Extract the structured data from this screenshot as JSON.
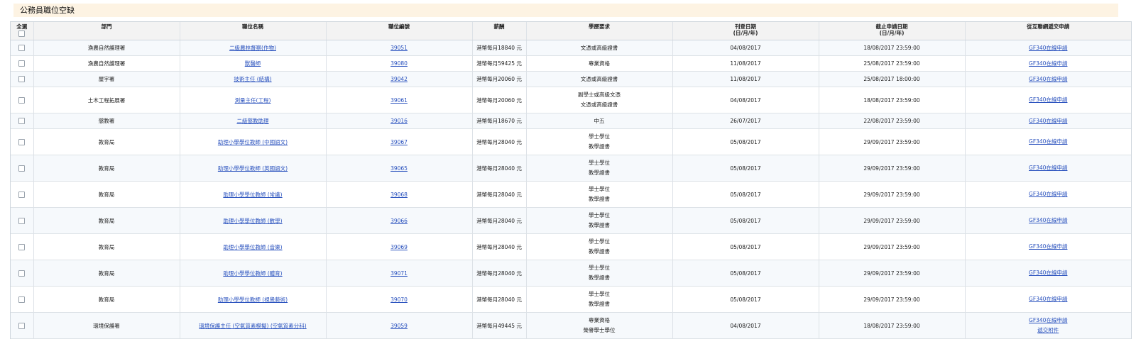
{
  "page": {
    "title": "公務員職位空缺"
  },
  "table": {
    "headers": {
      "select_all": "全選",
      "department": "部門",
      "position": "職位名稱",
      "ref": "職位編號",
      "salary": "薪酬",
      "requirement": "學歷要求",
      "publish_line1": "刊登日期",
      "publish_line2": "(日/月/年)",
      "deadline_line1": "截止申請日期",
      "deadline_line2": "(日/月/年)",
      "apply": "從互聯網遞交申請"
    },
    "rows": [
      {
        "department": "漁農自然護理署",
        "position": "二級農林督察(作物)",
        "ref": "39051",
        "salary": "港幣每月18840 元",
        "requirement": [
          "文憑或高級證書"
        ],
        "publish": "04/08/2017",
        "deadline": "18/08/2017 23:59:00",
        "apply": [
          "GF340在線申請"
        ]
      },
      {
        "department": "漁農自然護理署",
        "position": "獸醫師",
        "ref": "39080",
        "salary": "港幣每月59425 元",
        "requirement": [
          "專業資格"
        ],
        "publish": "11/08/2017",
        "deadline": "25/08/2017 23:59:00",
        "apply": [
          "GF340在線申請"
        ]
      },
      {
        "department": "屋宇署",
        "position": "技術主任 (結構)",
        "ref": "39042",
        "salary": "港幣每月20060 元",
        "requirement": [
          "文憑或高級證書"
        ],
        "publish": "11/08/2017",
        "deadline": "25/08/2017 18:00:00",
        "apply": [
          "GF340在線申請"
        ]
      },
      {
        "department": "土木工程拓展署",
        "position": "測量主任(工程)",
        "ref": "39061",
        "salary": "港幣每月20060 元",
        "requirement": [
          "副學士或高級文憑",
          "文憑或高級證書"
        ],
        "publish": "04/08/2017",
        "deadline": "18/08/2017 23:59:00",
        "apply": [
          "GF340在線申請"
        ]
      },
      {
        "department": "懲教署",
        "position": "二級懲教助理",
        "ref": "39016",
        "salary": "港幣每月18670 元",
        "requirement": [
          "中五"
        ],
        "publish": "26/07/2017",
        "deadline": "22/08/2017 23:59:00",
        "apply": [
          "GF340在線申請"
        ]
      },
      {
        "department": "教育局",
        "position": "助理小學學位教師 (中國語文)",
        "ref": "39067",
        "salary": "港幣每月28040 元",
        "requirement": [
          "學士學位",
          "教學證書"
        ],
        "publish": "05/08/2017",
        "deadline": "29/09/2017 23:59:00",
        "apply": [
          "GF340在線申請"
        ]
      },
      {
        "department": "教育局",
        "position": "助理小學學位教師 (英國語文)",
        "ref": "39065",
        "salary": "港幣每月28040 元",
        "requirement": [
          "學士學位",
          "教學證書"
        ],
        "publish": "05/08/2017",
        "deadline": "29/09/2017 23:59:00",
        "apply": [
          "GF340在線申請"
        ]
      },
      {
        "department": "教育局",
        "position": "助理小學學位教師 (常識)",
        "ref": "39068",
        "salary": "港幣每月28040 元",
        "requirement": [
          "學士學位",
          "教學證書"
        ],
        "publish": "05/08/2017",
        "deadline": "29/09/2017 23:59:00",
        "apply": [
          "GF340在線申請"
        ]
      },
      {
        "department": "教育局",
        "position": "助理小學學位教師 (數學)",
        "ref": "39066",
        "salary": "港幣每月28040 元",
        "requirement": [
          "學士學位",
          "教學證書"
        ],
        "publish": "05/08/2017",
        "deadline": "29/09/2017 23:59:00",
        "apply": [
          "GF340在線申請"
        ]
      },
      {
        "department": "教育局",
        "position": "助理小學學位教師 (音樂)",
        "ref": "39069",
        "salary": "港幣每月28040 元",
        "requirement": [
          "學士學位",
          "教學證書"
        ],
        "publish": "05/08/2017",
        "deadline": "29/09/2017 23:59:00",
        "apply": [
          "GF340在線申請"
        ]
      },
      {
        "department": "教育局",
        "position": "助理小學學位教師 (體育)",
        "ref": "39071",
        "salary": "港幣每月28040 元",
        "requirement": [
          "學士學位",
          "教學證書"
        ],
        "publish": "05/08/2017",
        "deadline": "29/09/2017 23:59:00",
        "apply": [
          "GF340在線申請"
        ]
      },
      {
        "department": "教育局",
        "position": "助理小學學位教師 (視覺藝術)",
        "ref": "39070",
        "salary": "港幣每月28040 元",
        "requirement": [
          "學士學位",
          "教學證書"
        ],
        "publish": "05/08/2017",
        "deadline": "29/09/2017 23:59:00",
        "apply": [
          "GF340在線申請"
        ]
      },
      {
        "department": "環境保護署",
        "position": "環境保護主任 (空氣質素模擬) (空氣質素分科)",
        "ref": "39059",
        "salary": "港幣每月49445 元",
        "requirement": [
          "專業資格",
          "榮譽學士學位"
        ],
        "publish": "04/08/2017",
        "deadline": "18/08/2017 23:59:00",
        "apply": [
          "GF340在線申請",
          "遞交附件"
        ]
      }
    ]
  }
}
